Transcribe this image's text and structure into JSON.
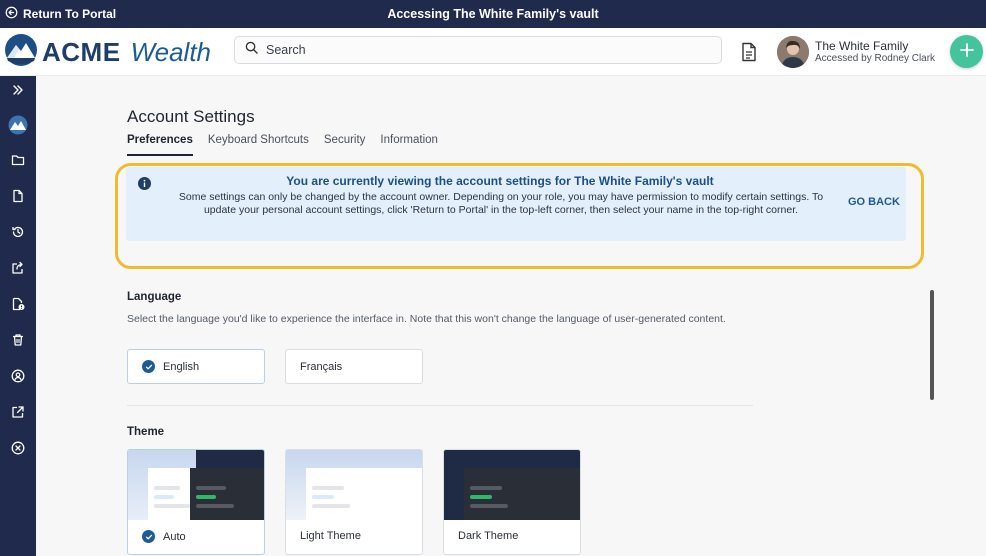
{
  "topbar": {
    "return_label": "Return To Portal",
    "title": "Accessing The White Family's vault"
  },
  "header": {
    "logo_acme": "ACME",
    "logo_wealth": "Wealth",
    "search_placeholder": "Search",
    "user_name": "The White Family",
    "user_sub": "Accessed by Rodney Clark"
  },
  "sidebar": {
    "icons": [
      "chevrons-right-icon",
      "logo-mountain-icon",
      "folder-icon",
      "document-icon",
      "history-icon",
      "share-icon",
      "document-alert-icon",
      "trash-icon",
      "user-circle-icon",
      "external-link-icon",
      "close-circle-icon"
    ]
  },
  "page": {
    "title": "Account Settings",
    "tabs": [
      {
        "label": "Preferences",
        "active": true
      },
      {
        "label": "Keyboard Shortcuts",
        "active": false
      },
      {
        "label": "Security",
        "active": false
      },
      {
        "label": "Information",
        "active": false
      }
    ]
  },
  "banner": {
    "title": "You are currently viewing the account settings for The White Family's vault",
    "body": "Some settings can only be changed by the account owner. Depending on your role, you may have permission to modify certain settings. To update your personal account settings, click 'Return to Portal' in the top-left corner, then select your name in the top-right corner.",
    "action": "GO BACK"
  },
  "language": {
    "title": "Language",
    "description": "Select the language you'd like to experience the interface in. Note that this won't change the language of user-generated content.",
    "options": [
      {
        "label": "English",
        "selected": true
      },
      {
        "label": "Français",
        "selected": false
      }
    ]
  },
  "theme": {
    "title": "Theme",
    "options": [
      {
        "label": "Auto",
        "selected": true
      },
      {
        "label": "Light Theme",
        "selected": false
      },
      {
        "label": "Dark Theme",
        "selected": false
      }
    ]
  },
  "colors": {
    "navy": "#1f2a4d",
    "accent_green": "#43c49d",
    "highlight": "#eebc2e",
    "banner_bg": "#e3effb",
    "link_blue": "#1d5a96"
  }
}
